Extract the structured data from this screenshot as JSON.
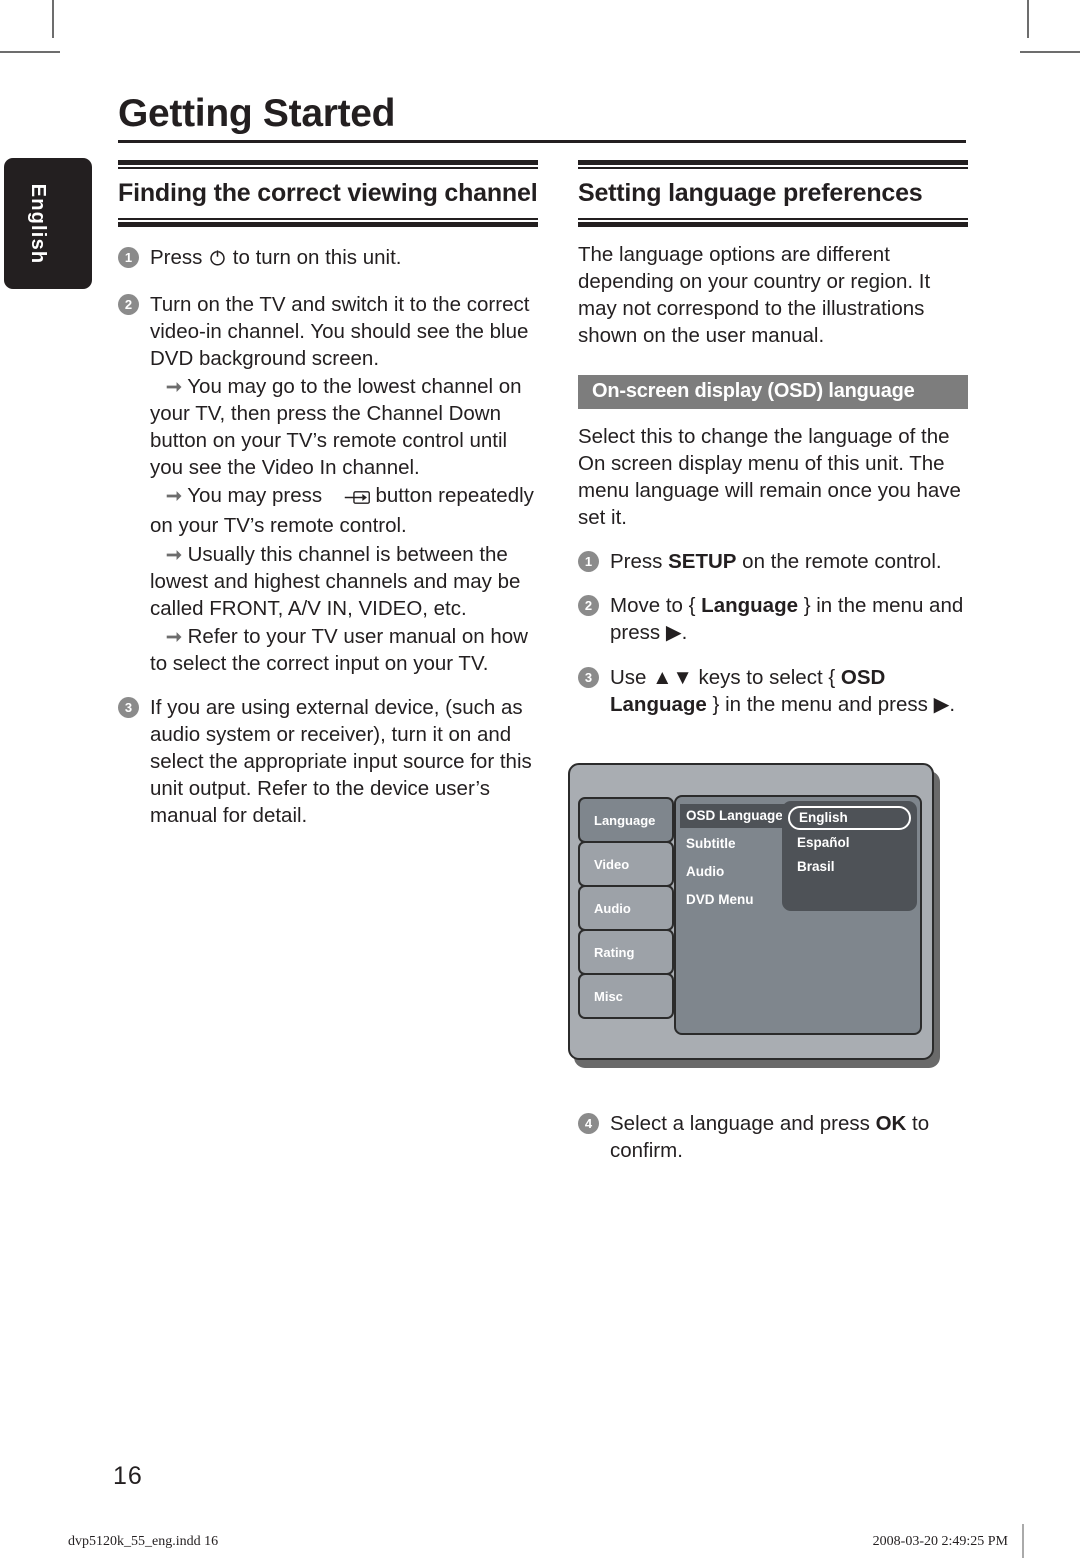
{
  "document": {
    "chapter_title": "Getting Started",
    "page_number": "16",
    "side_tab_label": "English"
  },
  "left_column": {
    "section_title": "Finding the correct viewing channel",
    "steps": [
      {
        "num": "1",
        "text_before": "Press ",
        "icon": "power-icon",
        "text_after": " to turn on this unit.",
        "sub_items": []
      },
      {
        "num": "2",
        "text": "Turn on the TV and switch it to the correct video-in channel. You should see the blue DVD background screen.",
        "sub_items": [
          "You may go to the lowest channel on your TV, then press the Channel Down button on your TV’s remote control until you see the Video In channel.",
          "You may press ▮ button repeatedly on your TV’s remote control.",
          "Usually this channel is between the lowest and highest channels and may be called FRONT, A/V IN, VIDEO, etc.",
          "Refer to your TV user manual on how to select the correct input on your TV."
        ]
      },
      {
        "num": "3",
        "text": "If you are using external device, (such as audio system or receiver), turn it on and select the appropriate input source for this unit output. Refer to the device user’s manual for detail.",
        "sub_items": []
      }
    ],
    "sub_item_2_part_a": "You may press ",
    "sub_item_2_part_b": " button repeatedly on your TV’s remote control."
  },
  "right_column": {
    "section_title": "Setting language preferences",
    "intro": "The language options are different depending on your country or region. It may not correspond to the illustrations shown on the user manual.",
    "grey_heading": "On-screen display (OSD) language",
    "description": "Select this to change the language of the On screen display menu of this unit. The menu language will remain once you have set it.",
    "steps": [
      {
        "num": "1",
        "parts": [
          {
            "t": "Press ",
            "b": false
          },
          {
            "t": "SETUP",
            "b": true
          },
          {
            "t": " on the remote control.",
            "b": false
          }
        ]
      },
      {
        "num": "2",
        "parts": [
          {
            "t": "Move to { ",
            "b": false
          },
          {
            "t": "Language",
            "b": true
          },
          {
            "t": " } in the menu and press ",
            "b": false
          },
          {
            "t": "▶",
            "b": false
          },
          {
            "t": ".",
            "b": false
          }
        ]
      },
      {
        "num": "3",
        "parts": [
          {
            "t": "Use ",
            "b": false
          },
          {
            "t": "▲▼",
            "b": false
          },
          {
            "t": " keys to select { ",
            "b": false
          },
          {
            "t": "OSD Language",
            "b": true
          },
          {
            "t": " } in the menu and press ",
            "b": false
          },
          {
            "t": "▶",
            "b": false
          },
          {
            "t": ".",
            "b": false
          }
        ]
      },
      {
        "num": "4",
        "parts": [
          {
            "t": "Select a language and press ",
            "b": false
          },
          {
            "t": "OK",
            "b": true
          },
          {
            "t": " to confirm.",
            "b": false
          }
        ]
      }
    ],
    "step1_text": "Press SETUP on the remote control.",
    "step2_text": "Move to { Language } in the menu and press ▶.",
    "step3_text": "Use ▲▼ keys to select { OSD Language } in the menu and press ▶.",
    "step4_text": "Select a language and press OK to confirm."
  },
  "osd_illustration": {
    "tabs": [
      {
        "label": "Language",
        "active": true
      },
      {
        "label": "Video",
        "active": false
      },
      {
        "label": "Audio",
        "active": false
      },
      {
        "label": "Rating",
        "active": false
      },
      {
        "label": "Misc",
        "active": false
      }
    ],
    "menu_items": [
      {
        "label": "OSD Language",
        "highlighted": true
      },
      {
        "label": "Subtitle",
        "highlighted": false
      },
      {
        "label": "Audio",
        "highlighted": false
      },
      {
        "label": "DVD Menu",
        "highlighted": false
      }
    ],
    "options": [
      {
        "label": "English",
        "selected": true
      },
      {
        "label": "Español",
        "selected": false
      },
      {
        "label": "Brasil",
        "selected": false
      }
    ]
  },
  "footer": {
    "left": "dvp5120k_55_eng.indd   16",
    "right": "2008-03-20   2:49:25 PM"
  },
  "colors": {
    "ink": "#231f20",
    "step_circle": "#8b8b8b",
    "grey_bar": "#7d7d7d",
    "osd_screen": "#a9adb2",
    "osd_panel": "#7f868d",
    "osd_highlight": "#4e5257"
  }
}
